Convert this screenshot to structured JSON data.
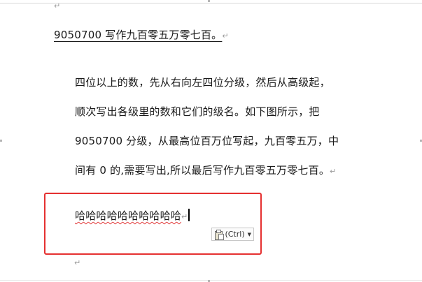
{
  "document": {
    "heading": "9050700 写作九百零五万零七百。",
    "paragraph_lines": [
      "四位以上的数，先从右向左四位分级，然后从高级起，",
      "顺次写出各级里的数和它们的级名。如下图所示，把",
      "9050700 分级，从最高位百万位写起，九百零五万，中",
      "间有 0 的,需要写出,所以最后写作九百零五万零七百。"
    ],
    "pasted_text": "哈哈哈哈哈哈哈哈哈哈",
    "paragraph_mark": "↵"
  },
  "paste_options": {
    "label": "(Ctrl)",
    "icon": "clipboard-paste-icon",
    "chevron": "chevron-down-icon"
  },
  "colors": {
    "highlight_border": "#e53030",
    "spell_squiggle": "#e23b3b",
    "grammar_squiggle": "#3aa43a"
  }
}
